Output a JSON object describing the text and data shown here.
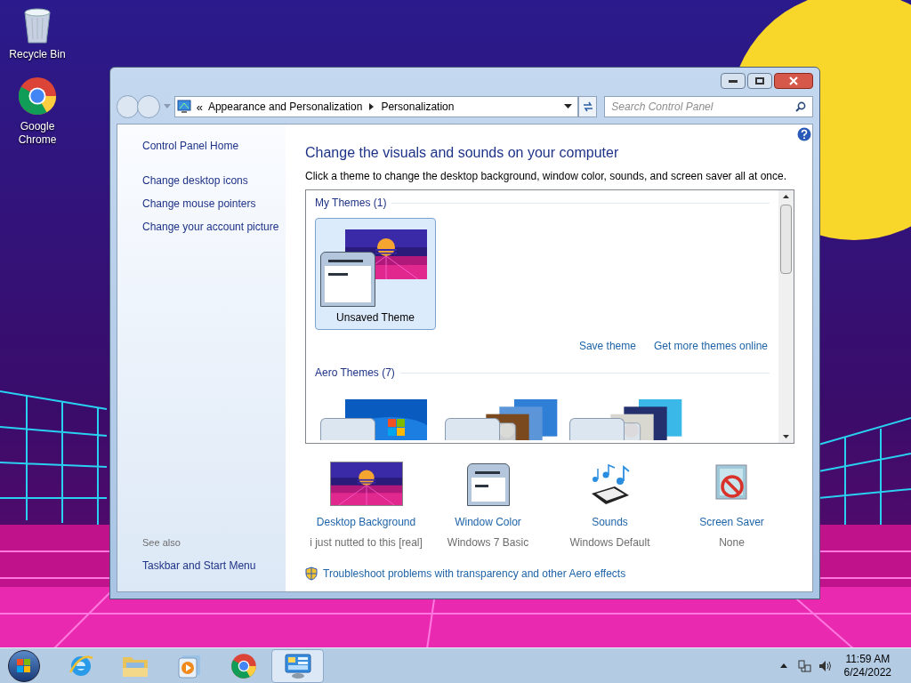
{
  "desktop_icons": [
    {
      "kind": "bin",
      "label": "Recycle Bin"
    },
    {
      "kind": "chrome",
      "label": "Google Chrome"
    }
  ],
  "window": {
    "address": {
      "overflow": "«",
      "breadcrumbs": [
        "Appearance and Personalization",
        "Personalization"
      ]
    },
    "search": {
      "placeholder": "Search Control Panel"
    }
  },
  "sidebar": {
    "home": "Control Panel Home",
    "links": [
      "Change desktop icons",
      "Change mouse pointers",
      "Change your account picture"
    ],
    "see_also": {
      "title": "See also",
      "links": [
        "Taskbar and Start Menu"
      ]
    }
  },
  "main": {
    "heading": "Change the visuals and sounds on your computer",
    "description": "Click a theme to change the desktop background, window color, sounds, and screen saver all at once.",
    "theme_groups": [
      {
        "title": "My Themes (1)",
        "themes": [
          {
            "kind": "single",
            "name": "Unsaved Theme",
            "selected": true
          }
        ],
        "actions": [
          "Save theme",
          "Get more themes online"
        ]
      },
      {
        "title": "Aero Themes (7)",
        "themes": [
          {
            "kind": "single",
            "selected": false
          },
          {
            "kind": "stack",
            "selected": false
          },
          {
            "kind": "stack",
            "selected": false
          }
        ]
      }
    ],
    "settings": [
      {
        "kind": "background",
        "label": "Desktop Background",
        "value": "i just nutted to this [real]"
      },
      {
        "kind": "window_color",
        "label": "Window Color",
        "value": "Windows 7 Basic"
      },
      {
        "kind": "sounds",
        "label": "Sounds",
        "value": "Windows Default"
      },
      {
        "kind": "screen_saver",
        "label": "Screen Saver",
        "value": "None"
      }
    ],
    "troubleshoot": "Troubleshoot problems with transparency and other Aero effects"
  },
  "taskbar": {
    "apps": [
      {
        "kind": "ie",
        "selected": false
      },
      {
        "kind": "explorer",
        "selected": false
      },
      {
        "kind": "media",
        "selected": false
      },
      {
        "kind": "chrome",
        "selected": false
      },
      {
        "kind": "control_panel",
        "selected": true
      }
    ],
    "clock": {
      "time": "11:59 AM",
      "date": "6/24/2022"
    }
  }
}
